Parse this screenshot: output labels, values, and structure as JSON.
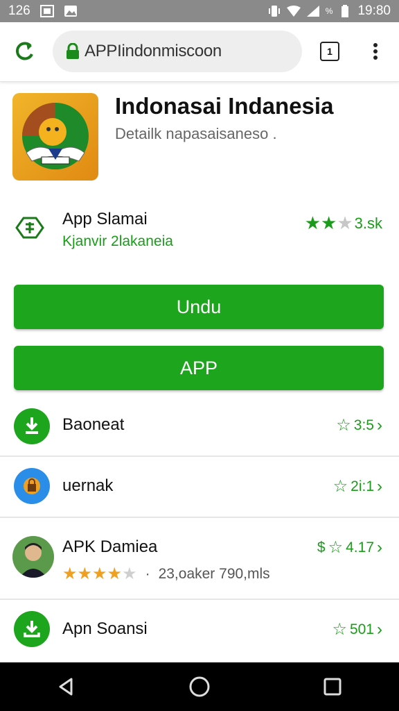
{
  "status_bar": {
    "left_text": "126",
    "time": "19:80",
    "battery_text": "%"
  },
  "browser": {
    "url": "APPIindonmiscoon",
    "tab_count": "1"
  },
  "app": {
    "title": "Indonasai Indanesia",
    "subtitle": "Detailk napasaisaneso ."
  },
  "info": {
    "name": "App Slamai",
    "developer": "Kjanvir 2lakaneia",
    "rating_value": "3.sk",
    "stars_filled": 2,
    "stars_total": 3
  },
  "buttons": {
    "primary_label": "Undu",
    "secondary_label": "APP"
  },
  "list": [
    {
      "title": "Baoneat",
      "rating": "3:5",
      "icon": "download-check-icon",
      "color": "#1ea51e"
    },
    {
      "title": "uernak",
      "rating": "2i:1",
      "icon": "lock-app-icon",
      "color": "#2a8ee8"
    },
    {
      "title": "APK Damiea",
      "rating": "4.17",
      "rating_prefix": "$",
      "sub": "23,oaker 790,mls",
      "sub_sep": "·",
      "stars_filled": 4,
      "stars_total": 5,
      "icon": "avatar"
    },
    {
      "title": "Apn Soansi",
      "rating": "501",
      "icon": "download-icon",
      "color": "#1ea51e"
    }
  ],
  "colors": {
    "accent_green": "#1ea51e",
    "status_bar": "#8a8a8a",
    "nav_bar": "#000000"
  }
}
